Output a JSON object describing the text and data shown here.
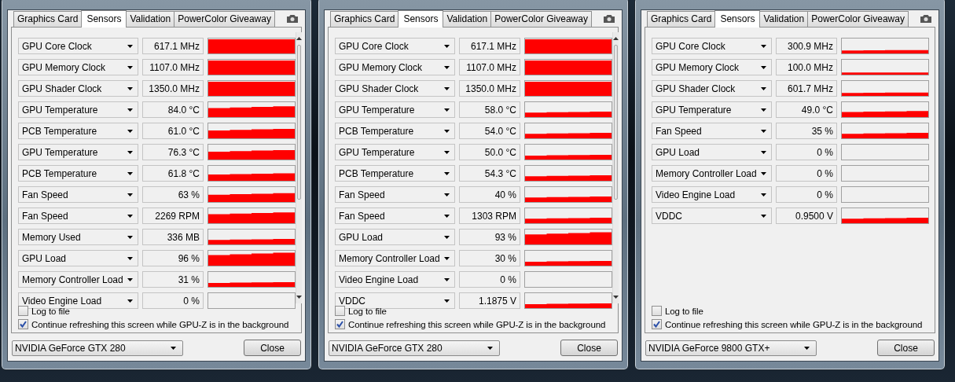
{
  "windows": [
    {
      "tabs": [
        {
          "label": "Graphics Card",
          "selected": false
        },
        {
          "label": "Sensors",
          "selected": true
        },
        {
          "label": "Validation",
          "selected": false
        },
        {
          "label": "PowerColor Giveaway",
          "selected": false
        }
      ],
      "sensors": [
        {
          "name": "GPU Core Clock",
          "value": "617.1 MHz"
        },
        {
          "name": "GPU Memory Clock",
          "value": "1107.0 MHz"
        },
        {
          "name": "GPU Shader Clock",
          "value": "1350.0 MHz"
        },
        {
          "name": "GPU Temperature",
          "value": "84.0 °C"
        },
        {
          "name": "PCB Temperature",
          "value": "61.0 °C"
        },
        {
          "name": "GPU Temperature",
          "value": "76.3 °C"
        },
        {
          "name": "PCB Temperature",
          "value": "61.8 °C"
        },
        {
          "name": "Fan Speed",
          "value": "63 %"
        },
        {
          "name": "Fan Speed",
          "value": "2269 RPM"
        },
        {
          "name": "Memory Used",
          "value": "336 MB"
        },
        {
          "name": "GPU Load",
          "value": "96 %"
        },
        {
          "name": "Memory Controller Load",
          "value": "31 %"
        },
        {
          "name": "Video Engine Load",
          "value": "0 %"
        }
      ],
      "options": [
        {
          "label": "Log to file",
          "checked": false
        },
        {
          "label": "Continue refreshing this screen while GPU-Z is in the background",
          "checked": true
        }
      ],
      "gpu": "NVIDIA GeForce GTX 280",
      "close": "Close"
    },
    {
      "tabs": [
        {
          "label": "Graphics Card",
          "selected": false
        },
        {
          "label": "Sensors",
          "selected": true
        },
        {
          "label": "Validation",
          "selected": false
        },
        {
          "label": "PowerColor Giveaway",
          "selected": false
        }
      ],
      "sensors": [
        {
          "name": "GPU Core Clock",
          "value": "617.1 MHz"
        },
        {
          "name": "GPU Memory Clock",
          "value": "1107.0 MHz"
        },
        {
          "name": "GPU Shader Clock",
          "value": "1350.0 MHz"
        },
        {
          "name": "GPU Temperature",
          "value": "58.0 °C"
        },
        {
          "name": "PCB Temperature",
          "value": "54.0 °C"
        },
        {
          "name": "GPU Temperature",
          "value": "50.0 °C"
        },
        {
          "name": "PCB Temperature",
          "value": "54.3 °C"
        },
        {
          "name": "Fan Speed",
          "value": "40 %"
        },
        {
          "name": "Fan Speed",
          "value": "1303 RPM"
        },
        {
          "name": "GPU Load",
          "value": "93 %"
        },
        {
          "name": "Memory Controller Load",
          "value": "30 %"
        },
        {
          "name": "Video Engine Load",
          "value": "0 %"
        },
        {
          "name": "VDDC",
          "value": "1.1875 V"
        }
      ],
      "options": [
        {
          "label": "Log to file",
          "checked": false
        },
        {
          "label": "Continue refreshing this screen while GPU-Z is in the background",
          "checked": true
        }
      ],
      "gpu": "NVIDIA GeForce GTX 280",
      "close": "Close"
    },
    {
      "tabs": [
        {
          "label": "Graphics Card",
          "selected": false
        },
        {
          "label": "Sensors",
          "selected": true
        },
        {
          "label": "Validation",
          "selected": false
        },
        {
          "label": "PowerColor Giveaway",
          "selected": false
        }
      ],
      "sensors": [
        {
          "name": "GPU Core Clock",
          "value": "300.9 MHz"
        },
        {
          "name": "GPU Memory Clock",
          "value": "100.0 MHz"
        },
        {
          "name": "GPU Shader Clock",
          "value": "601.7 MHz"
        },
        {
          "name": "GPU Temperature",
          "value": "49.0 °C"
        },
        {
          "name": "Fan Speed",
          "value": "35 %"
        },
        {
          "name": "GPU Load",
          "value": "0 %"
        },
        {
          "name": "Memory Controller Load",
          "value": "0 %"
        },
        {
          "name": "Video Engine Load",
          "value": "0 %"
        },
        {
          "name": "VDDC",
          "value": "0.9500 V"
        }
      ],
      "options": [
        {
          "label": "Log to file",
          "checked": false
        },
        {
          "label": "Continue refreshing this screen while GPU-Z is in the background",
          "checked": true
        }
      ],
      "gpu": "NVIDIA GeForce 9800 GTX+",
      "close": "Close"
    }
  ]
}
